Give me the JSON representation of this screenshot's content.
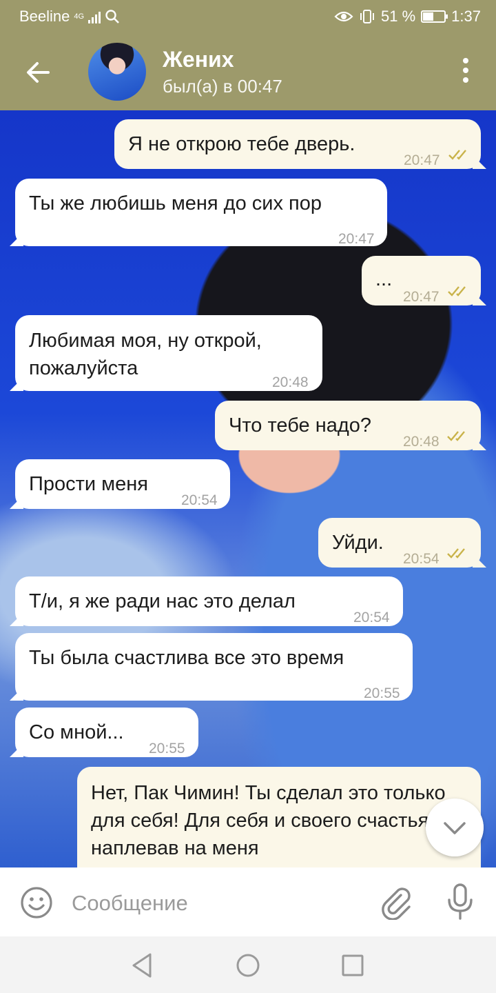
{
  "status_bar": {
    "carrier": "Beeline",
    "network": "4G",
    "battery_percent": "51 %",
    "battery_level": 0.51,
    "time": "1:37"
  },
  "header": {
    "contact_name": "Жених",
    "last_seen": "был(а) в 00:47",
    "accent_color": "#9d9a6b"
  },
  "messages": [
    {
      "dir": "out",
      "text": "Я не открою тебе дверь.",
      "time": "20:47",
      "read": true
    },
    {
      "dir": "in",
      "text": "Ты же любишь меня до сих пор",
      "time": "20:47"
    },
    {
      "dir": "out",
      "text": "...",
      "time": "20:47",
      "read": true
    },
    {
      "dir": "in",
      "text": "Любимая моя, ну открой, пожалуйста",
      "time": "20:48"
    },
    {
      "dir": "out",
      "text": "Что тебе надо?",
      "time": "20:48",
      "read": true
    },
    {
      "dir": "in",
      "text": "Прости меня",
      "time": "20:54"
    },
    {
      "dir": "out",
      "text": "Уйди.",
      "time": "20:54",
      "read": true
    },
    {
      "dir": "in",
      "text": "Т/и, я же ради нас это делал",
      "time": "20:54"
    },
    {
      "dir": "in",
      "text": "Ты была счастлива все это время",
      "time": "20:55"
    },
    {
      "dir": "in",
      "text": "Со мной...",
      "time": "20:55"
    },
    {
      "dir": "out",
      "text": "Нет, Пак Чимин! Ты сделал это только для себя! Для себя и своего счастья наплевав на меня",
      "time": ""
    }
  ],
  "composer": {
    "placeholder": "Сообщение"
  },
  "icons": {
    "back": "arrow-left-icon",
    "more": "more-vertical-icon",
    "emoji": "smiley-icon",
    "attach": "paperclip-icon",
    "mic": "microphone-icon",
    "scroll_down": "chevron-down-icon",
    "read_ticks": "double-check-icon"
  },
  "colors": {
    "read_tick": "#c9b34a",
    "outgoing_bubble": "#fbf7e8",
    "incoming_bubble": "#ffffff"
  }
}
